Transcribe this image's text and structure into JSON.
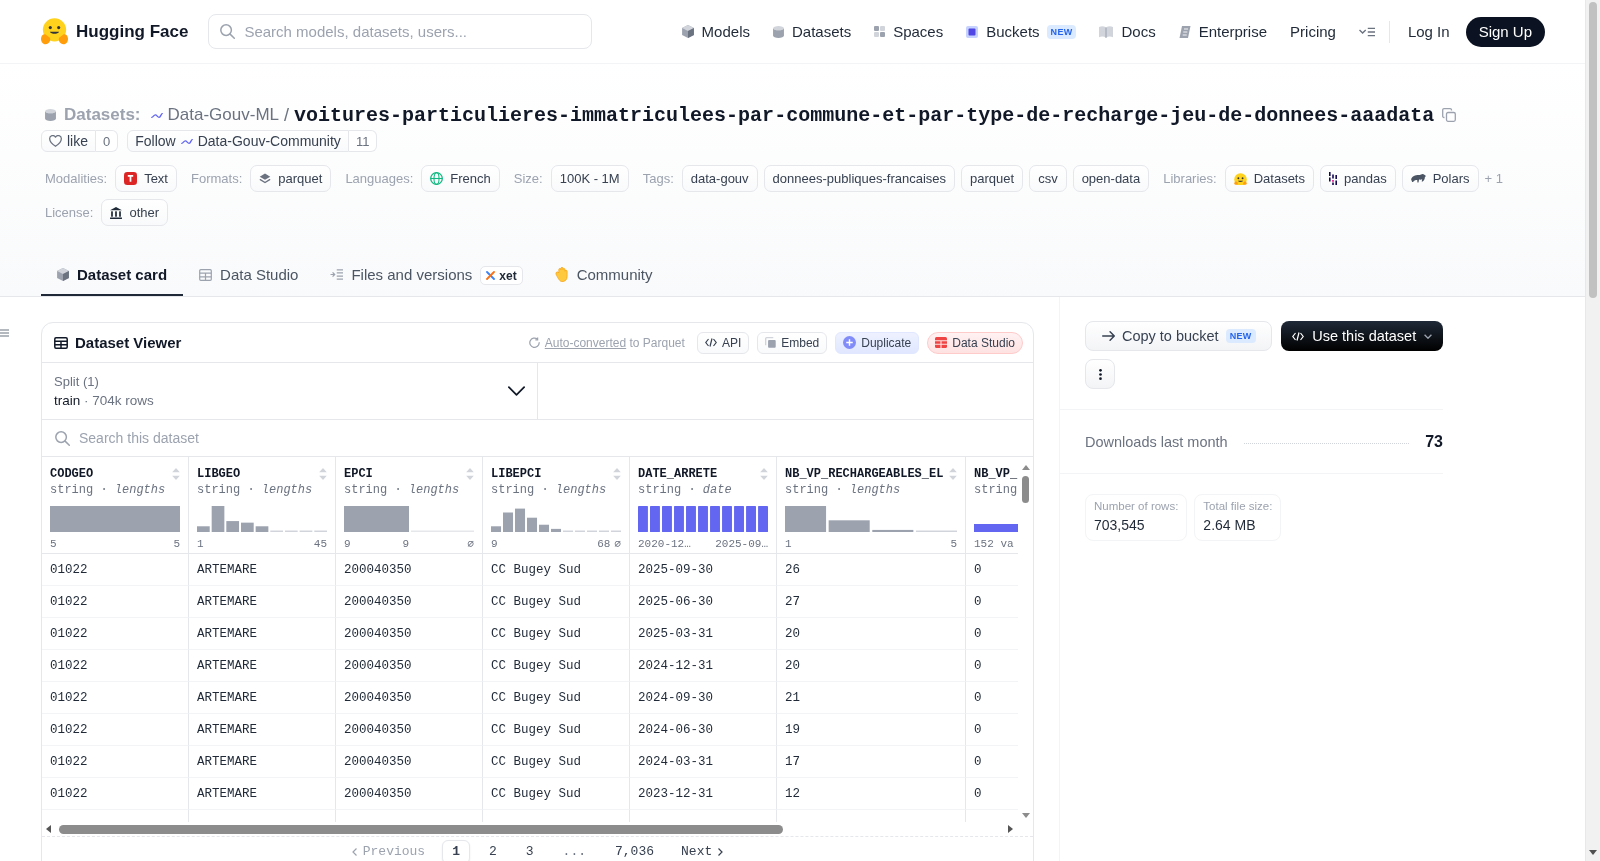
{
  "header": {
    "logo": "Hugging Face",
    "search": {
      "placeholder": "Search models, datasets, users..."
    },
    "nav": [
      {
        "label": "Models"
      },
      {
        "label": "Datasets"
      },
      {
        "label": "Spaces"
      },
      {
        "label": "Buckets",
        "badge": "NEW"
      },
      {
        "label": "Docs"
      },
      {
        "label": "Enterprise"
      },
      {
        "label": "Pricing"
      }
    ],
    "login": "Log In",
    "signup": "Sign Up"
  },
  "repo": {
    "type": "Datasets:",
    "owner": "Data-Gouv-ML",
    "separator": "/",
    "name": "voitures-particulieres-immatriculees-par-commune-et-par-type-de-recharge-jeu-de-donnees-aaadata",
    "like": {
      "label": "like",
      "count": "0"
    },
    "follow": {
      "label": "Follow",
      "org": "Data-Gouv-Community",
      "count": "11"
    },
    "metadata": [
      {
        "label": "Modalities:",
        "chips": [
          "Text"
        ]
      },
      {
        "label": "Formats:",
        "chips": [
          "parquet"
        ]
      },
      {
        "label": "Languages:",
        "chips": [
          "French"
        ]
      },
      {
        "label": "Size:",
        "chips": [
          "100K - 1M"
        ]
      },
      {
        "label": "Tags:",
        "chips": [
          "data-gouv",
          "donnees-publiques-francaises",
          "parquet",
          "csv",
          "open-data"
        ]
      },
      {
        "label": "Libraries:",
        "chips": [
          "Datasets",
          "pandas",
          "Polars"
        ],
        "more": "+ 1"
      },
      {
        "label": "License:",
        "chips": [
          "other"
        ]
      }
    ]
  },
  "tabs": [
    {
      "label": "Dataset card",
      "selected": true
    },
    {
      "label": "Data Studio",
      "selected": false
    },
    {
      "label": "Files and versions",
      "selected": false,
      "badge": "xet"
    },
    {
      "label": "Community",
      "selected": false
    }
  ],
  "viewer": {
    "title": "Dataset Viewer",
    "conversion": {
      "link": "Auto-converted",
      "text": "to Parquet"
    },
    "buttons": [
      {
        "label": "API",
        "kind": "api"
      },
      {
        "label": "Embed",
        "kind": "embed"
      },
      {
        "label": "Duplicate",
        "kind": "duplicate"
      },
      {
        "label": "Data Studio",
        "kind": "studio"
      }
    ],
    "split": {
      "label": "Split (1)",
      "value": "train",
      "separator": "·",
      "rows": "704k rows"
    },
    "search": {
      "placeholder": "Search this dataset"
    },
    "columns": [
      {
        "name": "CODGEO",
        "type": "string · *lengths*",
        "kind": "histogram",
        "labels": [
          "5",
          "5"
        ]
      },
      {
        "name": "LIBGEO",
        "type": "string · *lengths*",
        "kind": "histogram",
        "labels": [
          "1",
          "45"
        ]
      },
      {
        "name": "EPCI",
        "type": "string · *lengths*",
        "kind": "histogram",
        "labels": [
          "9",
          "9"
        ],
        "null_label": "∅"
      },
      {
        "name": "LIBEPCI",
        "type": "string · *lengths*",
        "kind": "histogram",
        "labels": [
          "9",
          "68"
        ],
        "null_label": "∅"
      },
      {
        "name": "DATE_ARRETE",
        "type": "string · *date*",
        "kind": "timeline",
        "labels": [
          "2020-12…",
          "2025-09…"
        ]
      },
      {
        "name": "NB_VP_RECHARGEABLES_EL",
        "type": "string · *lengths*",
        "kind": "histogram",
        "labels": [
          "1",
          "5"
        ]
      },
      {
        "name": "NB_VP_",
        "type": "string",
        "kind": "categories",
        "labels": [
          "152 va"
        ]
      }
    ],
    "rows": [
      [
        "01022",
        "ARTEMARE",
        "200040350",
        "CC Bugey Sud",
        "2025-09-30",
        "26",
        "0"
      ],
      [
        "01022",
        "ARTEMARE",
        "200040350",
        "CC Bugey Sud",
        "2025-06-30",
        "27",
        "0"
      ],
      [
        "01022",
        "ARTEMARE",
        "200040350",
        "CC Bugey Sud",
        "2025-03-31",
        "20",
        "0"
      ],
      [
        "01022",
        "ARTEMARE",
        "200040350",
        "CC Bugey Sud",
        "2024-12-31",
        "20",
        "0"
      ],
      [
        "01022",
        "ARTEMARE",
        "200040350",
        "CC Bugey Sud",
        "2024-09-30",
        "21",
        "0"
      ],
      [
        "01022",
        "ARTEMARE",
        "200040350",
        "CC Bugey Sud",
        "2024-06-30",
        "19",
        "0"
      ],
      [
        "01022",
        "ARTEMARE",
        "200040350",
        "CC Bugey Sud",
        "2024-03-31",
        "17",
        "0"
      ],
      [
        "01022",
        "ARTEMARE",
        "200040350",
        "CC Bugey Sud",
        "2023-12-31",
        "12",
        "0"
      ]
    ],
    "pagination": {
      "previous": {
        "label": "Previous",
        "disabled": true
      },
      "pages": [
        {
          "label": "1",
          "kind": "page",
          "selected": true
        },
        {
          "label": "2",
          "kind": "page",
          "selected": false
        },
        {
          "label": "3",
          "kind": "page",
          "selected": false
        },
        {
          "label": "...",
          "kind": "gap",
          "selected": false
        },
        {
          "label": "7,036",
          "kind": "page",
          "selected": false
        }
      ],
      "next": {
        "label": "Next",
        "disabled": false
      }
    }
  },
  "sidebar": {
    "copy_button": {
      "label": "Copy to bucket",
      "badge": "NEW"
    },
    "use_button": {
      "label": "Use this dataset"
    },
    "downloads": {
      "label": "Downloads last month",
      "value": "73"
    },
    "stats": [
      {
        "label": "Number of rows:",
        "value": "703,545"
      },
      {
        "label": "Total file size:",
        "value": "2.64 MB"
      }
    ]
  }
}
